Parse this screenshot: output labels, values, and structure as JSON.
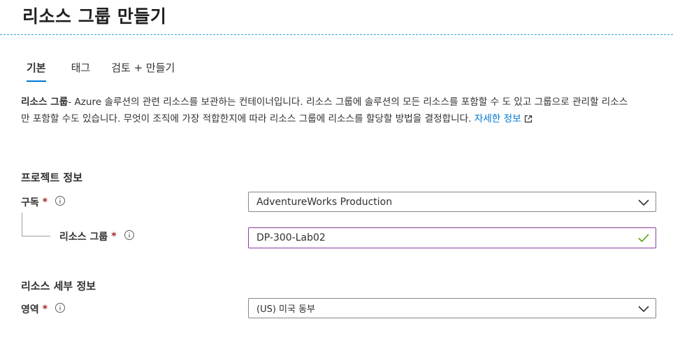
{
  "header": {
    "title": "리소스 그룹 만들기"
  },
  "tabs": [
    {
      "label": "기본",
      "active": true
    },
    {
      "label": "태그",
      "active": false
    },
    {
      "label": "검토 + 만들기",
      "active": false
    }
  ],
  "description": {
    "term": "리소스 그룹",
    "body": "- Azure 솔루션의 관련 리소스를 보관하는 컨테이너입니다. 리소스 그룹에 솔루션의 모든 리소스를 포함할 수 도 있고 그룹으로 관리할 리소스만 포함할 수도 있습니다. 무엇이 조직에 가장 적합한지에 따라 리소스 그룹에 리소스를 할당할 방법을 결정합니다. ",
    "link": "자세한 정보"
  },
  "project_section": {
    "heading": "프로젝트 정보",
    "subscription": {
      "label": "구독",
      "required": "*",
      "value": "AdventureWorks Production"
    },
    "resource_group": {
      "label": "리소스 그룹",
      "required": "*",
      "value": "DP-300-Lab02"
    }
  },
  "resource_section": {
    "heading": "리소스 세부 정보",
    "region": {
      "label": "영역",
      "required": "*",
      "value": "(US) 미국 동부"
    }
  },
  "colors": {
    "accent": "#0078d4",
    "required": "#a4262c",
    "focus_border": "#8a3c9c",
    "valid_check": "#57a300"
  },
  "icons": [
    "info-icon",
    "chevron-down-icon",
    "checkmark-icon",
    "external-link-icon"
  ]
}
